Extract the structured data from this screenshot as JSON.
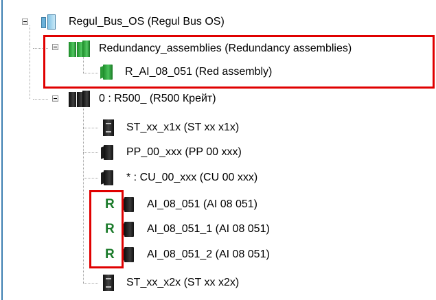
{
  "tree": {
    "root": {
      "label": "Regul_Bus_OS (Regul Bus OS)",
      "icon": "bus-icon"
    },
    "redundancy": {
      "label": "Redundancy_assemblies (Redundancy assemblies)",
      "icon": "green-modules-icon",
      "child": {
        "label": "R_AI_08_051 (Red assembly)",
        "icon": "green-module-icon"
      }
    },
    "crate": {
      "label": "0 : R500_ (R500 Крейт)",
      "icon": "black-modules-icon",
      "children": [
        {
          "label": "ST_xx_x1x (ST xx x1x)",
          "icon": "io-module-icon",
          "marker": ""
        },
        {
          "label": "PP_00_xxx (PP 00 xxx)",
          "icon": "black-module-icon",
          "marker": ""
        },
        {
          "label": "* : CU_00_xxx (CU 00 xxx)",
          "icon": "black-module-icon",
          "marker": ""
        },
        {
          "label": "AI_08_051 (AI 08 051)",
          "icon": "black-module-icon",
          "marker": "R"
        },
        {
          "label": "AI_08_051_1 (AI 08 051)",
          "icon": "black-module-icon",
          "marker": "R"
        },
        {
          "label": "AI_08_051_2 (AI 08 051)",
          "icon": "black-module-icon",
          "marker": "R"
        },
        {
          "label": "ST_xx_x2x (ST xx x2x)",
          "icon": "io-module-icon",
          "marker": ""
        }
      ]
    }
  },
  "colors": {
    "highlight_box": "#e00000",
    "redundancy_marker": "#1a7a2a",
    "frame": "#3c7fb1"
  }
}
